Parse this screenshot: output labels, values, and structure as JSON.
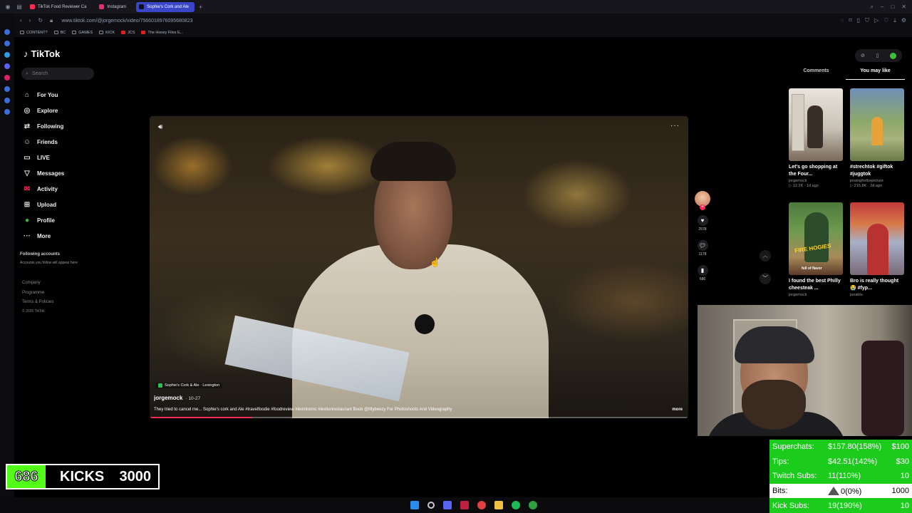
{
  "browser": {
    "tabs": [
      {
        "label": "TikTok Food Reviewer Ca",
        "color": "#fe2c55",
        "active": false
      },
      {
        "label": "Instagram",
        "color": "#e1306c",
        "active": false
      },
      {
        "label": "Sophie's Cork and Ale",
        "color": "#111111",
        "active": true
      }
    ],
    "url": "www.tiktok.com/@jorgemock/video/7566018976095680823",
    "bookmarks": [
      "CONTENT?",
      "BC",
      "GAMES",
      "KICK",
      "JCS",
      "The Honey Files E..."
    ]
  },
  "tiktok": {
    "logo": "TikTok",
    "search_placeholder": "Search",
    "nav": [
      {
        "label": "For You",
        "icon": "home-icon",
        "glyph": "⌂"
      },
      {
        "label": "Explore",
        "icon": "compass-icon",
        "glyph": "◎"
      },
      {
        "label": "Following",
        "icon": "following-icon",
        "glyph": "⇄"
      },
      {
        "label": "Friends",
        "icon": "friends-icon",
        "glyph": "☺"
      },
      {
        "label": "LIVE",
        "icon": "live-icon",
        "glyph": "▭"
      },
      {
        "label": "Messages",
        "icon": "messages-icon",
        "glyph": "▽"
      },
      {
        "label": "Activity",
        "icon": "activity-icon",
        "glyph": "✉"
      },
      {
        "label": "Upload",
        "icon": "upload-icon",
        "glyph": "⊞"
      },
      {
        "label": "Profile",
        "icon": "profile-icon",
        "glyph": "●"
      },
      {
        "label": "More",
        "icon": "more-icon",
        "glyph": "···"
      }
    ],
    "following_heading": "Following accounts",
    "following_sub": "Accounts you follow will appear here",
    "footer": [
      "Company",
      "Programme",
      "Terms & Policies"
    ],
    "copyright": "© 2025 TikTok"
  },
  "video": {
    "location": "Sophie's Cork & Ale · Lexington",
    "author": "jorgemock",
    "date": "· 10-27",
    "caption": "They tried to cancel me... Sophie's cork and Ale #travelfoodie #foodreview #lexintonnc #lexitonrestaurant Book @lillybeezy For Photoshoots And Videography",
    "more": "more",
    "progress": 0.19
  },
  "actions": {
    "likes": "2578",
    "comments": "1178",
    "saves": "686"
  },
  "right_panel": {
    "tabs": [
      "Comments",
      "You may like"
    ],
    "active_tab": 1,
    "cards": [
      {
        "title": "Let's go shopping at the Four...",
        "author": "jorgemock",
        "meta": "▷ 12.2K · 1d ago"
      },
      {
        "title": "#strechtok #giftok #juggtok",
        "author": "posingforthepicture",
        "meta": "▷ 215.8K · 2d ago"
      },
      {
        "title": "I found the best Philly cheesteak ...",
        "author": "jorgemock",
        "meta": "",
        "thumb_text": "FIRE HOGIES",
        "thumb_sub": "full of flavor"
      },
      {
        "title": "Bro is really thought 😭 #fyp...",
        "author": "junablu",
        "meta": ""
      }
    ]
  },
  "stream": {
    "kicks_current": "686",
    "kicks_label": "KICKS",
    "kicks_goal": "3000",
    "goals": [
      {
        "name": "Superchats:",
        "value": "$157.80(158%)",
        "target": "$100",
        "style": "green"
      },
      {
        "name": "Tips:",
        "value": "$42.51(142%)",
        "target": "$30",
        "style": "green"
      },
      {
        "name": "Twitch Subs:",
        "value": "11(110%)",
        "target": "10",
        "style": "green"
      },
      {
        "name": "Bits:",
        "value": "0(0%)",
        "target": "1000",
        "style": "white"
      },
      {
        "name": "Kick Subs:",
        "value": "19(190%)",
        "target": "10",
        "style": "green"
      }
    ]
  }
}
